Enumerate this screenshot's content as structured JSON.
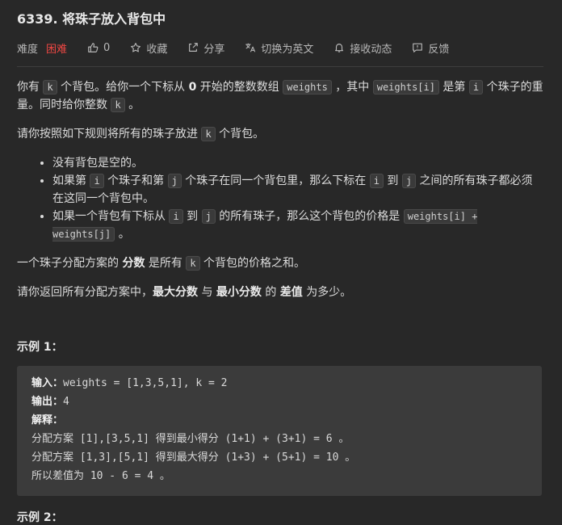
{
  "problem": {
    "title": "6339. 将珠子放入背包中"
  },
  "toolbar": {
    "difficulty_label": "难度",
    "difficulty_value": "困难",
    "like_count": "0",
    "favorite_label": "收藏",
    "share_label": "分享",
    "translate_label": "切换为英文",
    "notify_label": "接收动态",
    "feedback_label": "反馈",
    "colors": {
      "hard": "#ef4743"
    }
  },
  "desc": {
    "p1": {
      "t1": "你有 ",
      "c1": "k",
      "t2": " 个背包。给你一个下标从 ",
      "b1": "0",
      "t3": " 开始的整数数组 ",
      "c2": "weights",
      "t4": " ，其中 ",
      "c3": "weights[i]",
      "t5": " 是第 ",
      "c4": "i",
      "t6": " 个珠子的重量。同时给你整数 ",
      "c5": "k",
      "t7": " 。"
    },
    "p2": {
      "t1": "请你按照如下规则将所有的珠子放进 ",
      "c1": "k",
      "t2": " 个背包。"
    },
    "rules": {
      "r1": "没有背包是空的。",
      "r2": {
        "t1": "如果第 ",
        "c1": "i",
        "t2": " 个珠子和第 ",
        "c2": "j",
        "t3": " 个珠子在同一个背包里，那么下标在 ",
        "c3": "i",
        "t4": " 到 ",
        "c4": "j",
        "t5": " 之间的所有珠子都必须在这同一个背包中。"
      },
      "r3": {
        "t1": "如果一个背包有下标从 ",
        "c1": "i",
        "t2": " 到 ",
        "c2": "j",
        "t3": " 的所有珠子，那么这个背包的价格是 ",
        "c3": "weights[i] + weights[j]",
        "t4": " 。"
      }
    },
    "p3": {
      "t1": "一个珠子分配方案的 ",
      "b1": "分数",
      "t2": " 是所有 ",
      "c1": "k",
      "t3": " 个背包的价格之和。"
    },
    "p4": {
      "t1": "请你返回所有分配方案中，",
      "b1": "最大分数",
      "t2": " 与 ",
      "b2": "最小分数",
      "t3": " 的 ",
      "b3": "差值",
      "t4": " 为多少。"
    }
  },
  "example1": {
    "title": "示例 1：",
    "input_label": "输入：",
    "input_value": "weights = [1,3,5,1], k = 2",
    "output_label": "输出：",
    "output_value": "4",
    "explain_label": "解释：",
    "line1": "分配方案 [1],[3,5,1] 得到最小得分 (1+1) + (3+1) = 6 。",
    "line2": "分配方案 [1,3],[5,1] 得到最大得分 (1+3) + (5+1) = 10 。",
    "line3": "所以差值为 10 - 6 = 4 。"
  },
  "example2": {
    "title": "示例 2："
  }
}
